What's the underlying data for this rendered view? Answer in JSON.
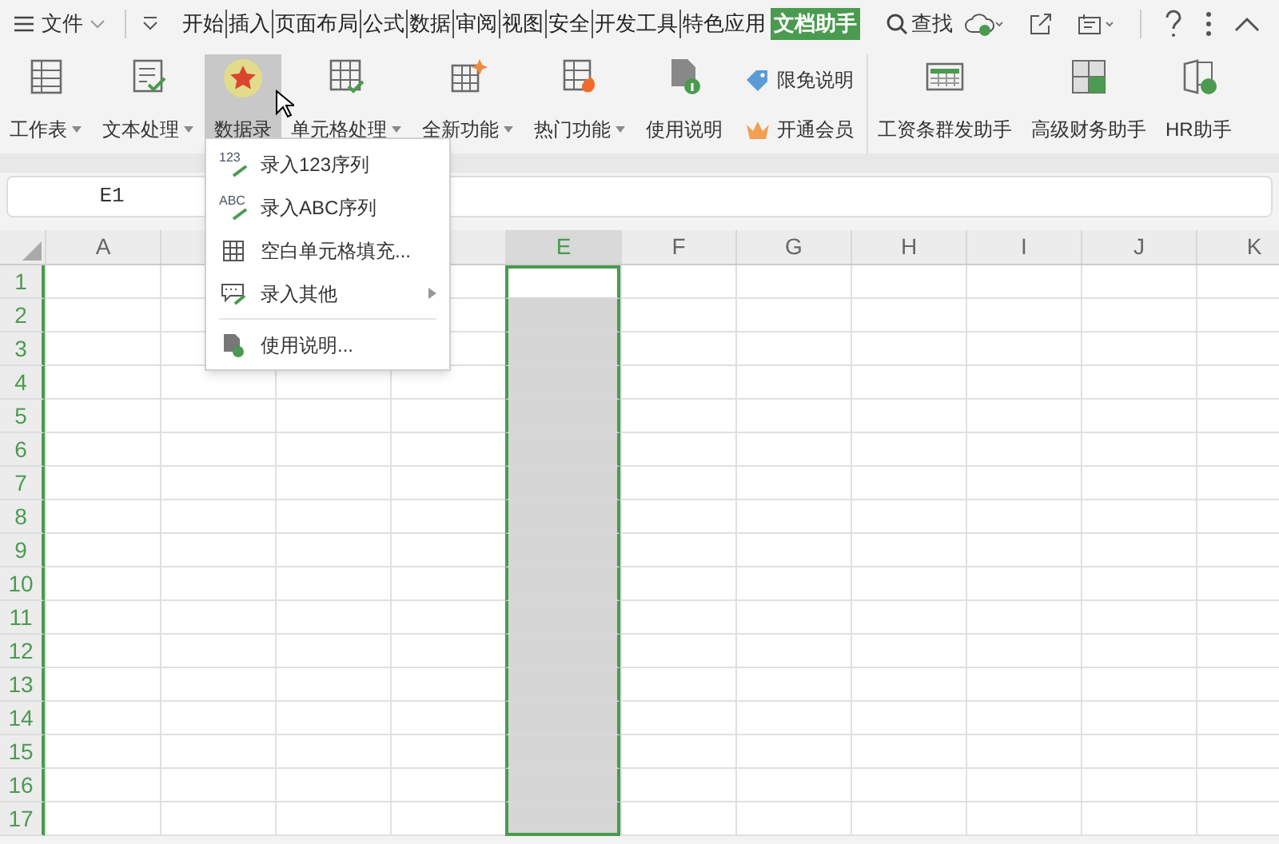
{
  "menu_bar": {
    "file_label": "文件",
    "tabs": [
      {
        "label": "开始",
        "selected": false
      },
      {
        "label": "插入",
        "selected": false
      },
      {
        "label": "页面布局",
        "selected": false
      },
      {
        "label": "公式",
        "selected": false
      },
      {
        "label": "数据",
        "selected": false
      },
      {
        "label": "审阅",
        "selected": false
      },
      {
        "label": "视图",
        "selected": false
      },
      {
        "label": "安全",
        "selected": false
      },
      {
        "label": "开发工具",
        "selected": false
      },
      {
        "label": "特色应用",
        "selected": false
      },
      {
        "label": "文档助手",
        "selected": true
      }
    ],
    "search_label": "查找"
  },
  "ribbon": {
    "groups": [
      {
        "kind": "big",
        "label": "工作表",
        "dropdown": true,
        "selected": false
      },
      {
        "kind": "big",
        "label": "文本处理",
        "dropdown": true,
        "selected": false
      },
      {
        "kind": "big",
        "label": "数据录",
        "dropdown": false,
        "selected": true
      },
      {
        "kind": "big",
        "label": "单元格处理",
        "dropdown": true,
        "selected": false
      },
      {
        "kind": "big",
        "label": "全新功能",
        "dropdown": true,
        "selected": false
      },
      {
        "kind": "big",
        "label": "热门功能",
        "dropdown": true,
        "selected": false
      },
      {
        "kind": "big",
        "label": "使用说明",
        "dropdown": false,
        "selected": false
      },
      {
        "kind": "stack",
        "items": [
          {
            "label": "限免说明"
          },
          {
            "label": "开通会员"
          }
        ]
      },
      {
        "kind": "big",
        "label": "工资条群发助手",
        "dropdown": false,
        "selected": false
      },
      {
        "kind": "big",
        "label": "高级财务助手",
        "dropdown": false,
        "selected": false
      },
      {
        "kind": "big",
        "label": "HR助手",
        "dropdown": false,
        "selected": false
      }
    ]
  },
  "dropdown_menu": {
    "items": [
      {
        "kind": "item",
        "icon_text": "123",
        "label": "录入123序列",
        "submenu": false
      },
      {
        "kind": "item",
        "icon_text": "ABC",
        "label": "录入ABC序列",
        "submenu": false
      },
      {
        "kind": "item",
        "label": "空白单元格填充...",
        "submenu": false
      },
      {
        "kind": "item",
        "label": "录入其他",
        "submenu": true
      },
      {
        "kind": "divider"
      },
      {
        "kind": "item",
        "label": "使用说明...",
        "submenu": false
      }
    ]
  },
  "name_box": "E1",
  "sheet": {
    "columns": [
      {
        "label": "A",
        "selected": false
      },
      {},
      {},
      {},
      {
        "label": "E",
        "selected": true
      },
      {
        "label": "F",
        "selected": false
      },
      {
        "label": "G",
        "selected": false
      },
      {
        "label": "H",
        "selected": false
      },
      {
        "label": "I",
        "selected": false
      },
      {
        "label": "J",
        "selected": false
      },
      {
        "label": "K",
        "selected": false
      }
    ],
    "rows": [
      "1",
      "2",
      "3",
      "4",
      "5",
      "6",
      "7",
      "8",
      "9",
      "10",
      "11",
      "12",
      "13",
      "14",
      "15",
      "16",
      "17"
    ]
  }
}
